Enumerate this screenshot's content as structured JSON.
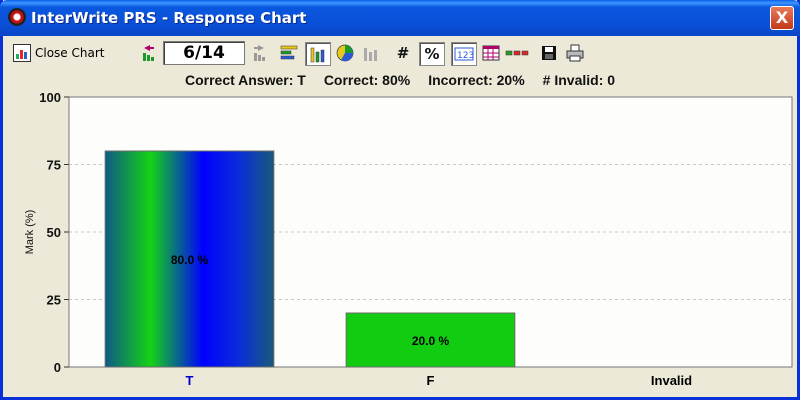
{
  "window": {
    "title": "InterWrite PRS - Response Chart",
    "close_glyph": "X"
  },
  "toolbar": {
    "close_chart_label": "Close Chart",
    "question_counter": "6/14",
    "hash_label": "#",
    "percent_label": "%",
    "icons": [
      "close-chart-icon",
      "previous-arrow-icon",
      "next-arrow-icon",
      "horizontal-bar-chart-icon",
      "vertical-bar-chart-icon",
      "pie-chart-icon",
      "disabled-bar-chart-icon",
      "count-toggle",
      "percent-toggle",
      "numbered-labels-icon",
      "grid-table-icon",
      "color-legend-icon",
      "save-icon",
      "print-icon"
    ]
  },
  "summary": {
    "correct_answer": "Correct Answer: T",
    "correct": "Correct: 80%",
    "incorrect": "Incorrect: 20%",
    "invalid": "# Invalid: 0"
  },
  "chart_data": {
    "type": "bar",
    "categories": [
      "T",
      "F",
      "Invalid"
    ],
    "values": [
      80,
      20,
      0
    ],
    "data_labels": [
      "80.0 %",
      "20.0 %",
      ""
    ],
    "ylabel": "Mark (%)",
    "ylim": [
      0,
      100
    ],
    "yticks": [
      0,
      25,
      50,
      75,
      100
    ],
    "grid": true,
    "colors": {
      "T": "gradient teal-green-blue",
      "F": "#11cc11",
      "correct_label": "#0000cc",
      "other_label": "#000000"
    }
  }
}
